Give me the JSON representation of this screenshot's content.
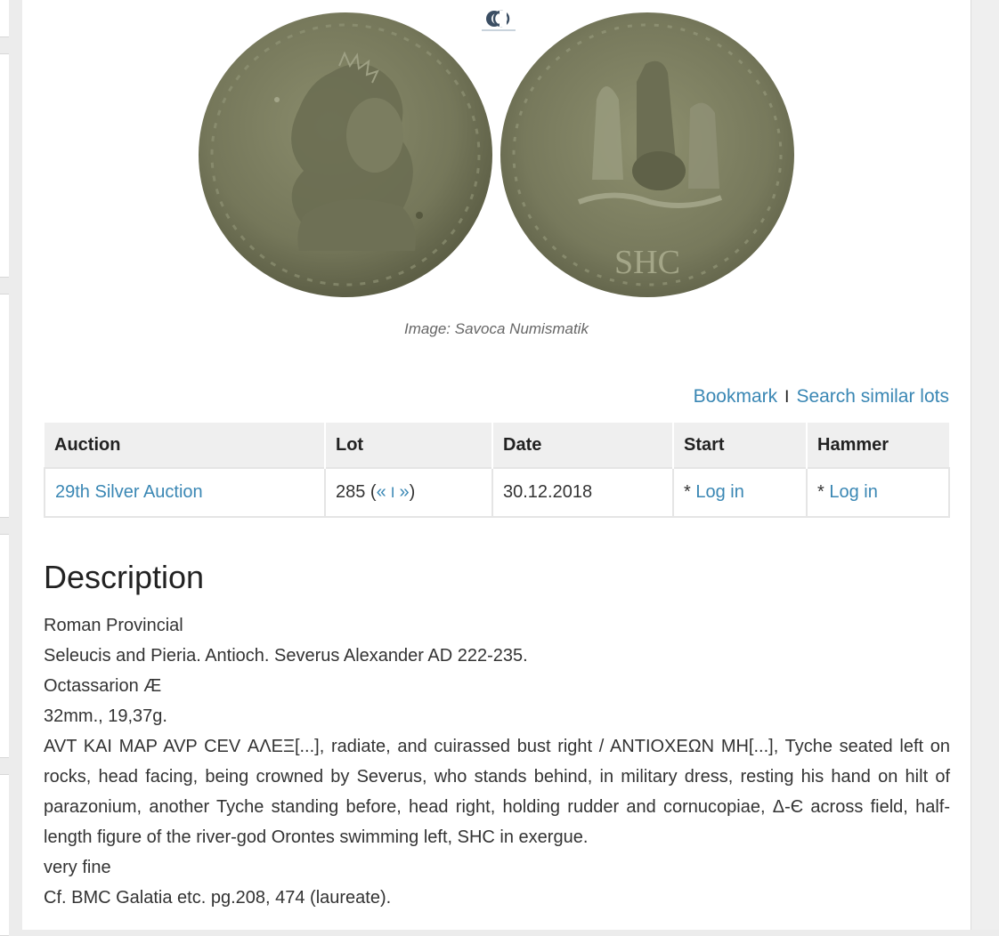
{
  "image": {
    "caption": "Image: Savoca Numismatik",
    "obverse_icon": "coin-obverse-bust",
    "reverse_icon": "coin-reverse-tyche",
    "watermark_icon": "savoca-logo",
    "reverse_exergue": "SHC"
  },
  "actions": {
    "bookmark": "Bookmark",
    "separator": "I",
    "search_similar": "Search similar lots"
  },
  "lots_table": {
    "headers": [
      "Auction",
      "Lot",
      "Date",
      "Start",
      "Hammer"
    ],
    "row": {
      "auction": "29th Silver Auction",
      "lot_number": "285 (",
      "prev": "«",
      "divider": "I",
      "next": "»",
      "lot_close": ")",
      "date": "30.12.2018",
      "start_prefix": "* ",
      "start_link": "Log in",
      "hammer_prefix": "* ",
      "hammer_link": "Log in"
    }
  },
  "description": {
    "title": "Description",
    "lines": [
      "Roman Provincial",
      "Seleucis and Pieria. Antioch. Severus Alexander AD 222-235.",
      "Octassarion Æ",
      "32mm., 19,37g.",
      "AVT KAI MAP AVP CEV ΑΛΕΞ[...], radiate, and cuirassed bust right / ANTIOXEΩN MH[...], Tyche seated left on rocks, head facing, being crowned by Severus, who stands behind, in military dress, resting his hand on hilt of parazonium, another Tyche standing before, head right, holding rudder and cornucopiae, Δ-Є across field, half-length figure of the river-god Orontes swimming left, SHC in exergue.",
      "very fine",
      "Cf. BMC Galatia etc. pg.208, 474 (laureate)."
    ]
  },
  "colors": {
    "link": "#3a87b4",
    "coin_base": "#7d7f60"
  }
}
